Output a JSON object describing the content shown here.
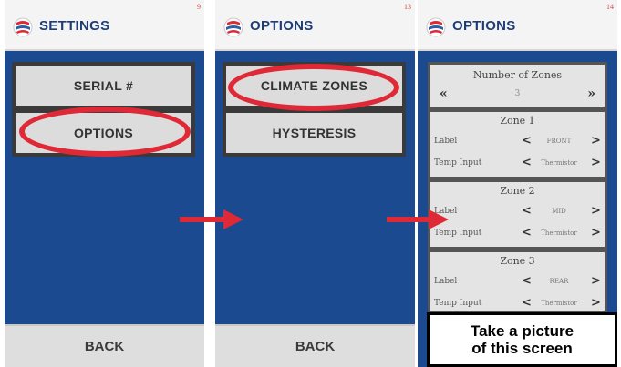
{
  "panels": {
    "settings": {
      "title": "SETTINGS",
      "page_number": "9",
      "buttons": [
        "SERIAL #",
        "OPTIONS"
      ],
      "back_label": "BACK"
    },
    "options": {
      "title": "OPTIONS",
      "page_number": "13",
      "buttons": [
        "CLIMATE ZONES",
        "HYSTERESIS"
      ],
      "back_label": "BACK"
    },
    "climate_zones": {
      "title": "OPTIONS",
      "page_number": "14",
      "number_of_zones": {
        "title": "Number of Zones",
        "left": "«",
        "value": "3",
        "right": "»"
      },
      "zones": [
        {
          "title": "Zone 1",
          "rows": [
            {
              "label": "Label",
              "value": "FRONT"
            },
            {
              "label": "Temp Input",
              "value": "Thermistor"
            }
          ]
        },
        {
          "title": "Zone 2",
          "rows": [
            {
              "label": "Label",
              "value": "MID"
            },
            {
              "label": "Temp Input",
              "value": "Thermistor"
            }
          ]
        },
        {
          "title": "Zone 3",
          "rows": [
            {
              "label": "Label",
              "value": "REAR"
            },
            {
              "label": "Temp Input",
              "value": "Thermistor"
            }
          ]
        }
      ],
      "row_left": "<",
      "row_right": ">"
    }
  },
  "callout": {
    "line1": "Take a picture",
    "line2": "of this screen"
  },
  "colors": {
    "panel_bg": "#1b4a90",
    "header_bg": "#f4f4f4",
    "highlight": "#e02936",
    "title_text": "#1e3c77"
  }
}
